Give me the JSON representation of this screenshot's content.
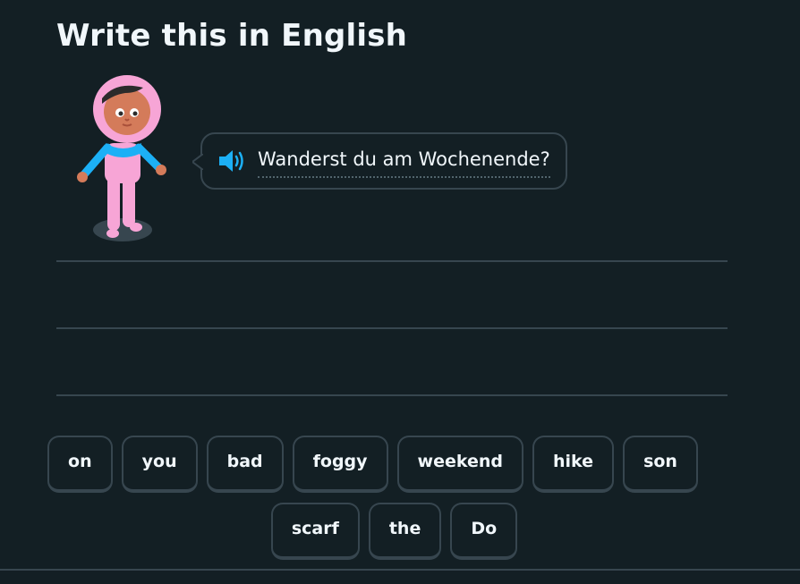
{
  "exercise": {
    "title": "Write this in English",
    "prompt": "Wanderst du am Wochenende?"
  },
  "word_bank": {
    "row1": [
      "on",
      "you",
      "bad",
      "foggy",
      "weekend",
      "hike",
      "son"
    ],
    "row2": [
      "scarf",
      "the",
      "Do"
    ]
  },
  "colors": {
    "background": "#131f24",
    "border": "#37464f",
    "text": "#f1f7fb",
    "speaker": "#1cb0f6"
  },
  "icons": {
    "speaker": "speaker-icon",
    "character": "character-avatar"
  }
}
